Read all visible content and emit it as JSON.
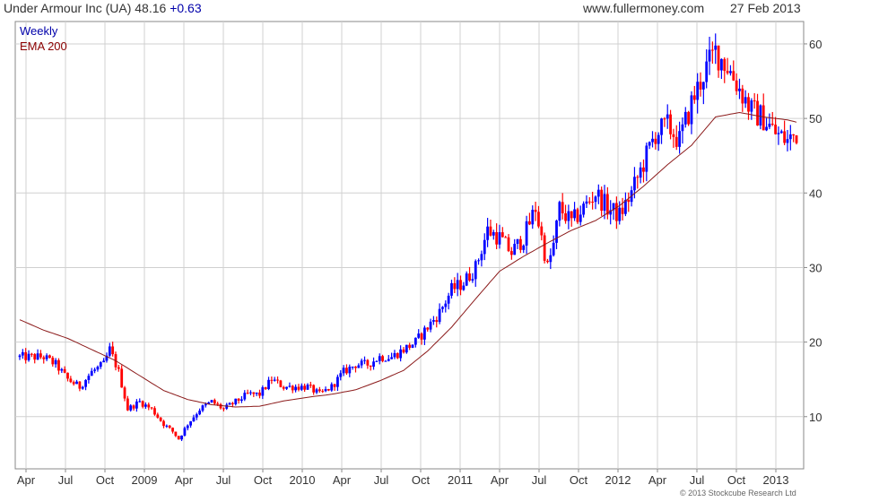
{
  "header": {
    "title": "Under Armour Inc (UA) 48.16",
    "change": "+0.63",
    "site": "www.fullermoney.com",
    "date": "27 Feb 2013"
  },
  "legend": {
    "weekly_label": "Weekly",
    "ema_label": "EMA 200",
    "weekly_color": "#0000aa",
    "ema_color": "#8b0000"
  },
  "copyright": "© 2013 Stockcube Research Ltd",
  "colors": {
    "up": "#0000ff",
    "down": "#ff0000",
    "grid": "#d0d0d0",
    "axis_text": "#333333",
    "ema": "#8b1a1a"
  },
  "chart_data": {
    "type": "candlestick",
    "frequency": "weekly",
    "x_tick_labels": [
      "Apr",
      "Jul",
      "Oct",
      "2009",
      "Apr",
      "Jul",
      "Oct",
      "2010",
      "Apr",
      "Jul",
      "Oct",
      "2011",
      "Apr",
      "Jul",
      "Oct",
      "2012",
      "Apr",
      "Jul",
      "Oct",
      "2013"
    ],
    "y_ticks": [
      10,
      20,
      30,
      40,
      50,
      60
    ],
    "ylim": [
      3,
      63
    ],
    "grid": true,
    "price_anchors": [
      [
        0,
        18
      ],
      [
        8,
        18
      ],
      [
        12,
        17
      ],
      [
        16,
        15
      ],
      [
        20,
        14
      ],
      [
        24,
        16
      ],
      [
        28,
        17
      ],
      [
        30,
        19
      ],
      [
        33,
        16
      ],
      [
        36,
        11
      ],
      [
        40,
        12
      ],
      [
        44,
        11
      ],
      [
        48,
        9
      ],
      [
        51,
        8
      ],
      [
        53,
        7
      ],
      [
        56,
        9
      ],
      [
        60,
        11
      ],
      [
        64,
        12
      ],
      [
        68,
        11
      ],
      [
        72,
        12
      ],
      [
        76,
        13
      ],
      [
        80,
        13
      ],
      [
        84,
        15
      ],
      [
        88,
        14
      ],
      [
        92,
        14
      ],
      [
        96,
        14
      ],
      [
        100,
        13
      ],
      [
        104,
        14
      ],
      [
        108,
        16
      ],
      [
        112,
        17
      ],
      [
        116,
        17
      ],
      [
        120,
        18
      ],
      [
        124,
        18
      ],
      [
        128,
        19
      ],
      [
        132,
        20
      ],
      [
        136,
        22
      ],
      [
        140,
        24
      ],
      [
        144,
        27
      ],
      [
        148,
        28
      ],
      [
        152,
        30
      ],
      [
        156,
        35
      ],
      [
        160,
        34
      ],
      [
        164,
        32
      ],
      [
        168,
        34
      ],
      [
        172,
        38
      ],
      [
        174,
        34
      ],
      [
        176,
        30
      ],
      [
        178,
        33
      ],
      [
        180,
        38
      ],
      [
        184,
        36
      ],
      [
        188,
        38
      ],
      [
        192,
        40
      ],
      [
        196,
        38
      ],
      [
        200,
        37
      ],
      [
        204,
        40
      ],
      [
        208,
        44
      ],
      [
        212,
        48
      ],
      [
        216,
        49
      ],
      [
        220,
        47
      ],
      [
        224,
        52
      ],
      [
        228,
        56
      ],
      [
        232,
        59
      ],
      [
        236,
        57
      ],
      [
        240,
        54
      ],
      [
        244,
        51
      ],
      [
        248,
        50
      ],
      [
        252,
        48
      ],
      [
        256,
        47
      ],
      [
        259,
        48
      ]
    ],
    "ema_anchors": [
      [
        0,
        23
      ],
      [
        8,
        21.6
      ],
      [
        16,
        20.5
      ],
      [
        24,
        19
      ],
      [
        32,
        17.5
      ],
      [
        40,
        15.5
      ],
      [
        48,
        13.5
      ],
      [
        56,
        12.3
      ],
      [
        64,
        11.6
      ],
      [
        72,
        11.3
      ],
      [
        80,
        11.4
      ],
      [
        88,
        12.1
      ],
      [
        96,
        12.6
      ],
      [
        104,
        13
      ],
      [
        112,
        13.6
      ],
      [
        120,
        14.8
      ],
      [
        128,
        16.2
      ],
      [
        136,
        18.8
      ],
      [
        144,
        22
      ],
      [
        152,
        25.8
      ],
      [
        160,
        29.5
      ],
      [
        168,
        31.5
      ],
      [
        176,
        33.3
      ],
      [
        184,
        35
      ],
      [
        192,
        36.3
      ],
      [
        200,
        38.3
      ],
      [
        208,
        40.9
      ],
      [
        216,
        43.8
      ],
      [
        224,
        46.4
      ],
      [
        232,
        50.2
      ],
      [
        240,
        50.8
      ],
      [
        248,
        50.2
      ],
      [
        256,
        49.8
      ],
      [
        259,
        49.5
      ]
    ]
  }
}
